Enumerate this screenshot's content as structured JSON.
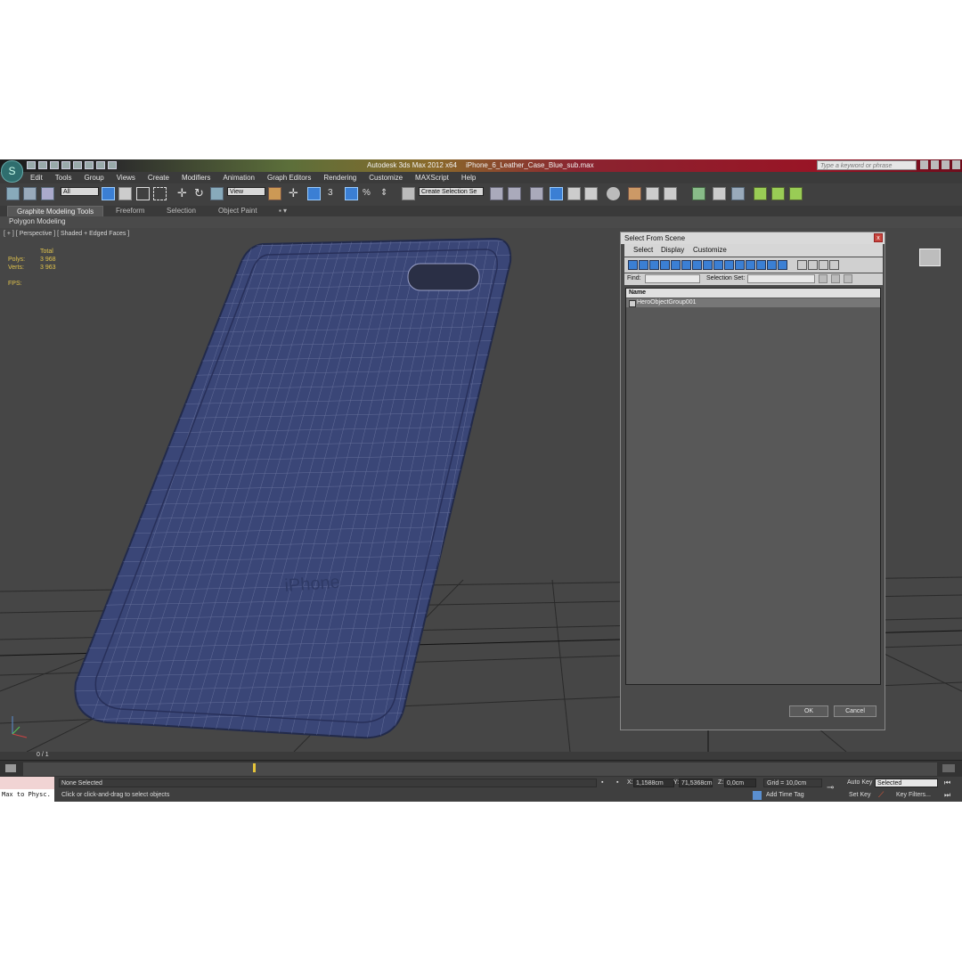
{
  "window": {
    "app_title": "Autodesk 3ds Max  2012 x64",
    "file_title": "iPhone_6_Leather_Case_Blue_sub.max",
    "search_placeholder": "Type a keyword or phrase"
  },
  "menu": [
    "Edit",
    "Tools",
    "Group",
    "Views",
    "Create",
    "Modifiers",
    "Animation",
    "Graph Editors",
    "Rendering",
    "Customize",
    "MAXScript",
    "Help"
  ],
  "toolbar": {
    "selection_filter": "All",
    "reference_coord": "View",
    "named_selection": "Create Selection Se"
  },
  "ribbon": {
    "tabs": [
      "Graphite Modeling Tools",
      "Freeform",
      "Selection",
      "Object Paint"
    ],
    "panel": "Polygon Modeling"
  },
  "viewport": {
    "label": "[ + ] [ Perspective ] [ Shaded + Edged Faces ]",
    "stats_header": "Total",
    "polys_label": "Polys:",
    "polys_value": "3 968",
    "verts_label": "Verts:",
    "verts_value": "3 963",
    "fps_label": "FPS:",
    "model_text": "iPhone"
  },
  "dialog": {
    "title": "Select From Scene",
    "close": "x",
    "menu": [
      "Select",
      "Display",
      "Customize"
    ],
    "find_label": "Find:",
    "selection_set_label": "Selection Set:",
    "column_name": "Name",
    "items": [
      "HeroObjectGroup001"
    ],
    "ok": "OK",
    "cancel": "Cancel"
  },
  "timeline": {
    "frame": "0 / 1"
  },
  "status": {
    "maxscript": "Max to Physc.",
    "selection": "None Selected",
    "prompt": "Click or click-and-drag to select objects",
    "x_label": "X:",
    "x_value": "1,1588cm",
    "y_label": "Y:",
    "y_value": "71,5368cm",
    "z_label": "Z:",
    "z_value": "0,0cm",
    "grid": "Grid = 10,0cm",
    "add_time_tag": "Add Time Tag",
    "auto_key": "Auto Key",
    "set_key": "Set Key",
    "key_mode": "Selected",
    "key_filters": "Key Filters..."
  },
  "colors": {
    "case_blue": "#3a4677",
    "wire": "#8890b8",
    "highlight": "#e5c43a"
  }
}
